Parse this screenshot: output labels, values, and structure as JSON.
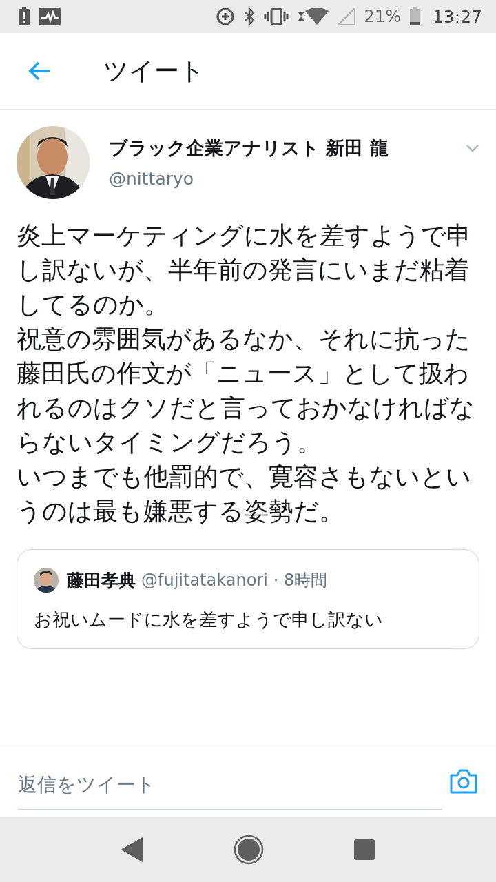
{
  "status_bar": {
    "battery_percent": "21%",
    "time": "13:27"
  },
  "header": {
    "title": "ツイート"
  },
  "tweet": {
    "author_name": "ブラック企業アナリスト 新田 龍",
    "handle": "@nittaryo",
    "paragraphs": [
      "炎上マーケティングに水を差すようで申し訳ないが、半年前の発言にいまだ粘着してるのか。",
      "祝意の雰囲気があるなか、それに抗った藤田氏の作文が「ニュース」として扱われるのはクソだと言っておかなければならないタイミングだろう。",
      "いつまでも他罰的で、寛容さもないというのは最も嫌悪する姿勢だ。"
    ]
  },
  "quoted_tweet": {
    "author_name": "藤田孝典",
    "handle": "@fujitatakanori",
    "time": "· 8時間",
    "text": "お祝いムードに水を差すようで申し訳ない"
  },
  "reply_bar": {
    "placeholder": "返信をツイート"
  }
}
